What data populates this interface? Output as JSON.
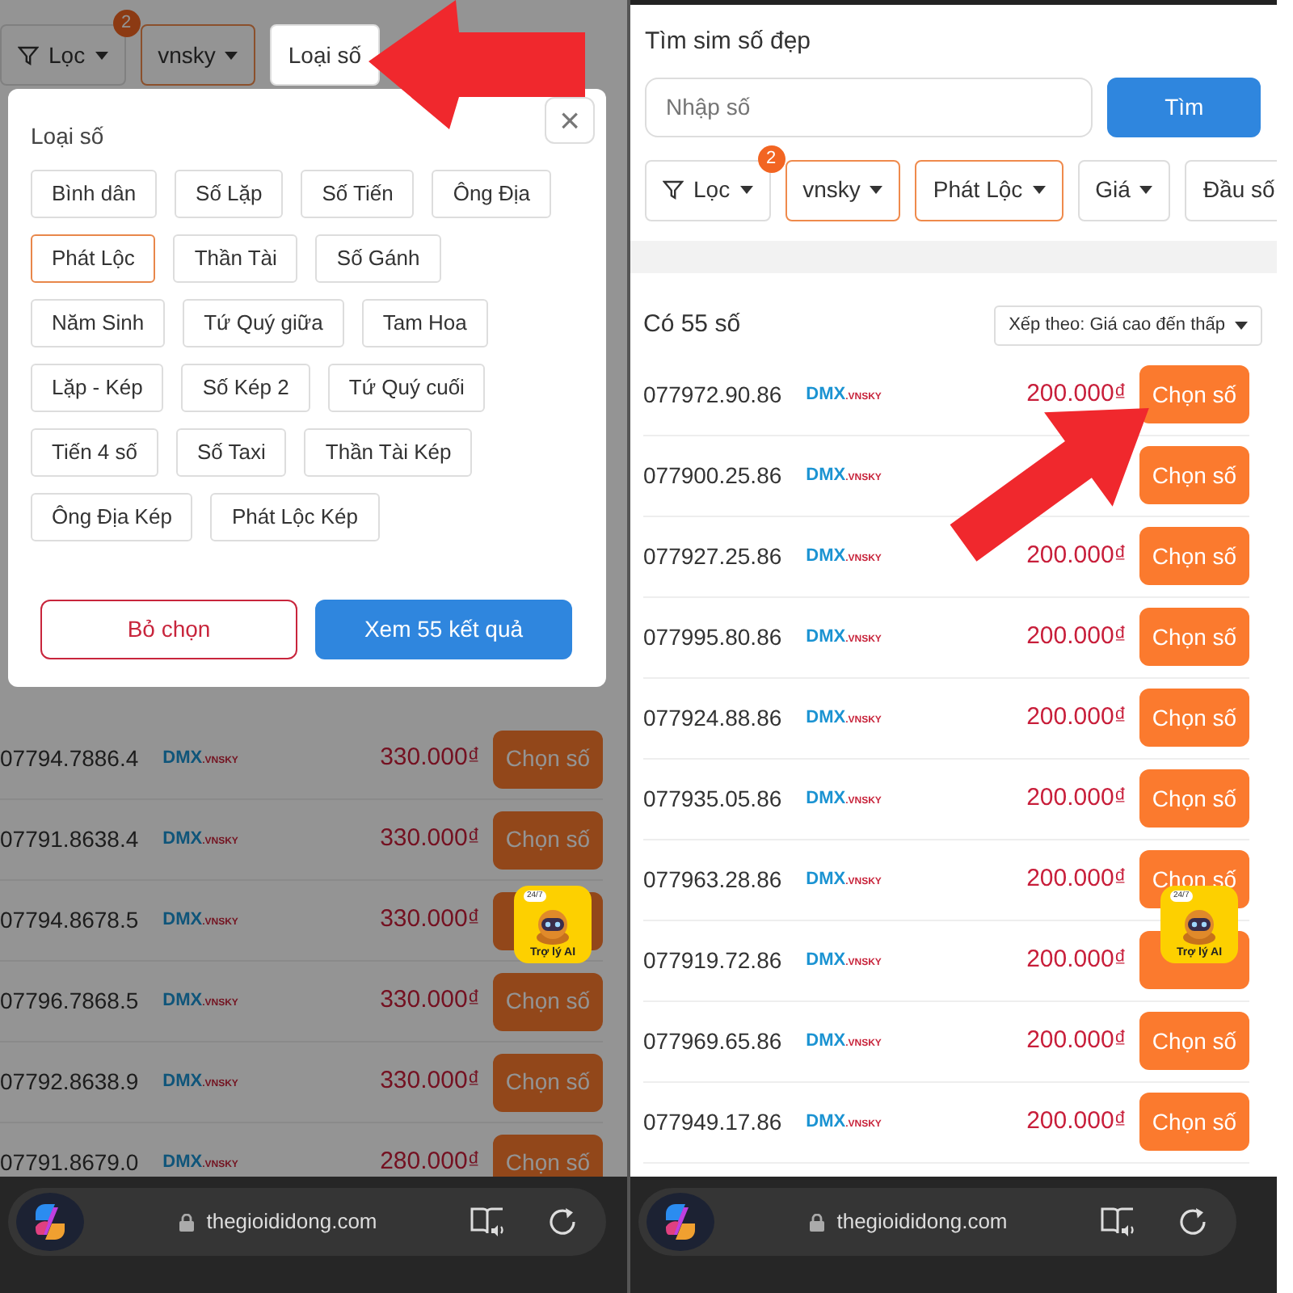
{
  "left_screen": {
    "filters": [
      {
        "label": "Lọc",
        "kind": "filter",
        "badge": "2",
        "selected": false,
        "open": false,
        "caret": true
      },
      {
        "label": "vnsky",
        "kind": "dropdown",
        "selected": true,
        "open": false,
        "caret": true
      },
      {
        "label": "Loại số",
        "kind": "dropdown",
        "selected": false,
        "open": true,
        "caret": false
      }
    ],
    "popup": {
      "title": "Loại số",
      "close": "×",
      "chip_rows": [
        [
          {
            "label": "Bình dân",
            "selected": false
          },
          {
            "label": "Số Lặp",
            "selected": false
          },
          {
            "label": "Số Tiến",
            "selected": false
          },
          {
            "label": "Ông Địa",
            "selected": false
          }
        ],
        [
          {
            "label": "Phát Lộc",
            "selected": true
          },
          {
            "label": "Thần Tài",
            "selected": false
          },
          {
            "label": "Số Gánh",
            "selected": false
          }
        ],
        [
          {
            "label": "Năm Sinh",
            "selected": false
          },
          {
            "label": "Tứ Quý giữa",
            "selected": false
          },
          {
            "label": "Tam Hoa",
            "selected": false
          }
        ],
        [
          {
            "label": "Lặp - Kép",
            "selected": false
          },
          {
            "label": "Số Kép 2",
            "selected": false
          },
          {
            "label": "Tứ Quý cuối",
            "selected": false
          }
        ],
        [
          {
            "label": "Tiến 4 số",
            "selected": false
          },
          {
            "label": "Số Taxi",
            "selected": false
          },
          {
            "label": "Thần Tài Kép",
            "selected": false
          }
        ],
        [
          {
            "label": "Ông Địa Kép",
            "selected": false
          },
          {
            "label": "Phát Lộc Kép",
            "selected": false
          }
        ]
      ],
      "clear_button": "Bỏ chọn",
      "apply_button": "Xem 55 kết quả"
    },
    "rows": [
      {
        "number": "07794.7886.4",
        "logo": "DMX",
        "logo_suffix": ".VNSKY",
        "price": "330.000₫",
        "button": "Chọn số"
      },
      {
        "number": "07791.8638.4",
        "logo": "DMX",
        "logo_suffix": ".VNSKY",
        "price": "330.000₫",
        "button": "Chọn số"
      },
      {
        "number": "07794.8678.5",
        "logo": "DMX",
        "logo_suffix": ".VNSKY",
        "price": "330.000₫"
      },
      {
        "number": "07796.7868.5",
        "logo": "DMX",
        "logo_suffix": ".VNSKY",
        "price": "330.000₫",
        "button": "Chọn số"
      },
      {
        "number": "07792.8638.9",
        "logo": "DMX",
        "logo_suffix": ".VNSKY",
        "price": "330.000₫",
        "button": "Chọn số"
      },
      {
        "number": "07791.8679.0",
        "logo": "DMX",
        "logo_suffix": ".VNSKY",
        "price": "280.000₫",
        "button": "Chọn số"
      }
    ],
    "assistant": {
      "label": "Trợ lý AI",
      "bubble": "24/7"
    }
  },
  "right_screen": {
    "title": "Tìm sim số đẹp",
    "search": {
      "placeholder": "Nhập số"
    },
    "search_button": "Tìm",
    "filters": [
      {
        "label": "Lọc",
        "kind": "filter",
        "badge": "2",
        "selected": false,
        "caret": true
      },
      {
        "label": "vnsky",
        "kind": "dropdown",
        "selected": true,
        "caret": true
      },
      {
        "label": "Phát Lộc",
        "kind": "dropdown",
        "selected": true,
        "caret": true
      },
      {
        "label": "Giá",
        "kind": "dropdown",
        "selected": false,
        "caret": true
      },
      {
        "label": "Đầu số",
        "kind": "dropdown",
        "selected": false,
        "caret": false
      }
    ],
    "count": "Có 55 số",
    "sort": "Xếp theo: Giá cao đến thấp",
    "rows": [
      {
        "number": "077972.90.86",
        "logo": "DMX",
        "logo_suffix": ".VNSKY",
        "price": "200.000₫",
        "button": "Chọn số"
      },
      {
        "number": "077900.25.86",
        "logo": "DMX",
        "logo_suffix": ".VNSKY",
        "button": "Chọn số"
      },
      {
        "number": "077927.25.86",
        "logo": "DMX",
        "logo_suffix": ".VNSKY",
        "price": "200.000₫",
        "button": "Chọn số"
      },
      {
        "number": "077995.80.86",
        "logo": "DMX",
        "logo_suffix": ".VNSKY",
        "price": "200.000₫",
        "button": "Chọn số"
      },
      {
        "number": "077924.88.86",
        "logo": "DMX",
        "logo_suffix": ".VNSKY",
        "price": "200.000₫",
        "button": "Chọn số"
      },
      {
        "number": "077935.05.86",
        "logo": "DMX",
        "logo_suffix": ".VNSKY",
        "price": "200.000₫",
        "button": "Chọn số"
      },
      {
        "number": "077963.28.86",
        "logo": "DMX",
        "logo_suffix": ".VNSKY",
        "price": "200.000₫",
        "button": "Chọn số"
      },
      {
        "number": "077919.72.86",
        "logo": "DMX",
        "logo_suffix": ".VNSKY",
        "price": "200.000₫"
      },
      {
        "number": "077969.65.86",
        "logo": "DMX",
        "logo_suffix": ".VNSKY",
        "price": "200.000₫",
        "button": "Chọn số"
      },
      {
        "number": "077949.17.86",
        "logo": "DMX",
        "logo_suffix": ".VNSKY",
        "price": "200.000₫",
        "button": "Chọn số"
      }
    ],
    "assistant": {
      "label": "Trợ lý AI",
      "bubble": "24/7"
    }
  },
  "browser_bars": [
    {
      "url": "thegioididong.com"
    },
    {
      "url": "thegioididong.com"
    }
  ]
}
